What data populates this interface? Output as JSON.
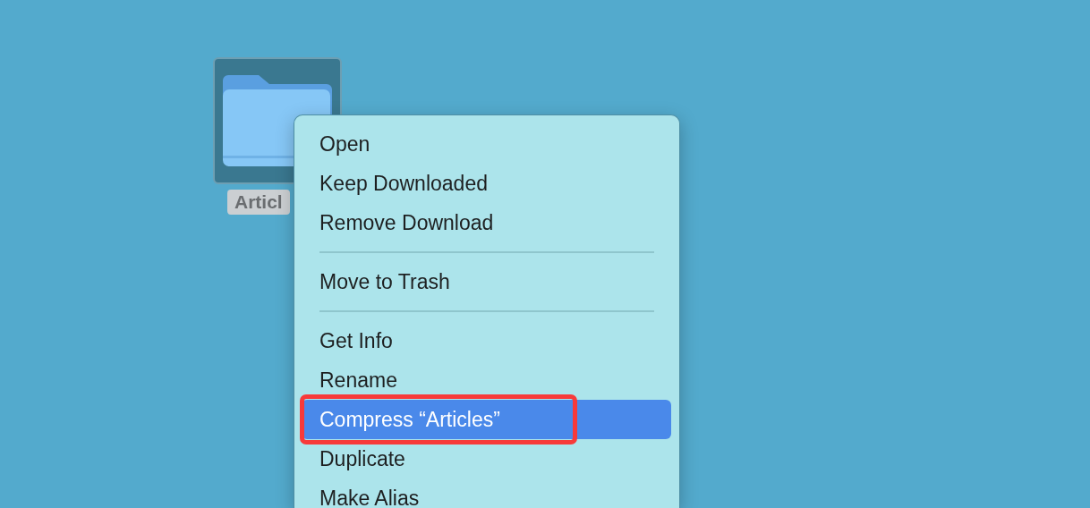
{
  "desktop": {
    "items": [
      {
        "label": "Articl",
        "selected": true
      }
    ]
  },
  "context_menu": {
    "items": [
      {
        "kind": "item",
        "label": "Open",
        "selected": false,
        "outlined": false
      },
      {
        "kind": "item",
        "label": "Keep Downloaded",
        "selected": false,
        "outlined": false
      },
      {
        "kind": "item",
        "label": "Remove Download",
        "selected": false,
        "outlined": false
      },
      {
        "kind": "separator"
      },
      {
        "kind": "item",
        "label": "Move to Trash",
        "selected": false,
        "outlined": false
      },
      {
        "kind": "separator"
      },
      {
        "kind": "item",
        "label": "Get Info",
        "selected": false,
        "outlined": false
      },
      {
        "kind": "item",
        "label": "Rename",
        "selected": false,
        "outlined": false
      },
      {
        "kind": "item",
        "label": "Compress “Articles”",
        "selected": true,
        "outlined": true
      },
      {
        "kind": "item",
        "label": "Duplicate",
        "selected": false,
        "outlined": false
      },
      {
        "kind": "item",
        "label": "Make Alias",
        "selected": false,
        "outlined": false
      }
    ]
  }
}
